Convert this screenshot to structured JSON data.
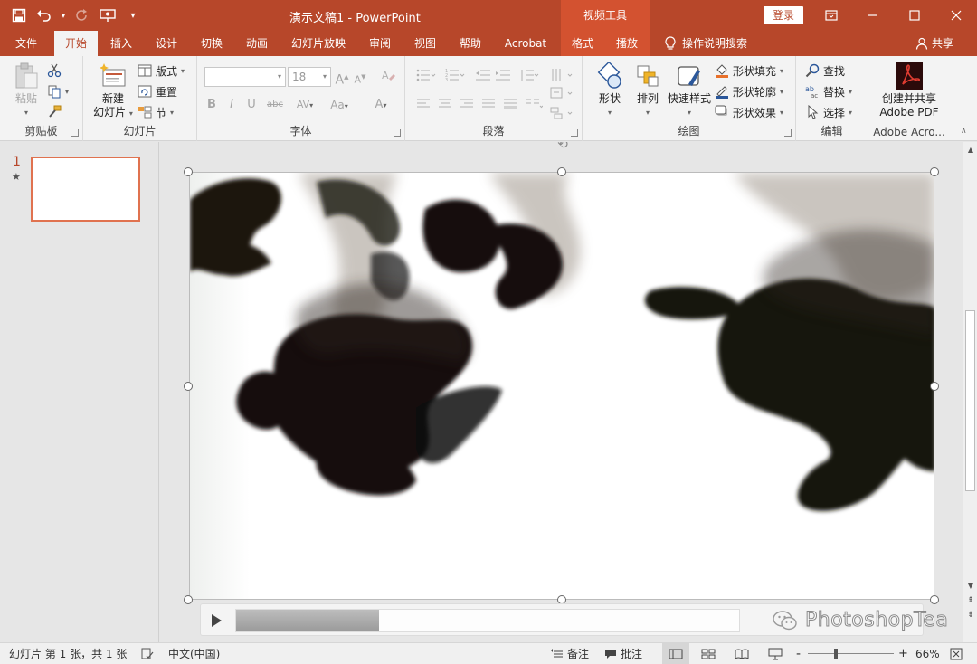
{
  "titlebar": {
    "title": "演示文稿1  -  PowerPoint",
    "context_group": "视频工具",
    "login_label": "登录"
  },
  "tabs": [
    {
      "label": "文件"
    },
    {
      "label": "开始"
    },
    {
      "label": "插入"
    },
    {
      "label": "设计"
    },
    {
      "label": "切换"
    },
    {
      "label": "动画"
    },
    {
      "label": "幻灯片放映"
    },
    {
      "label": "审阅"
    },
    {
      "label": "视图"
    },
    {
      "label": "帮助"
    },
    {
      "label": "Acrobat"
    },
    {
      "label": "格式"
    },
    {
      "label": "播放"
    }
  ],
  "active_tab": "开始",
  "tell_me": "操作说明搜索",
  "share": "共享",
  "ribbon": {
    "clipboard": {
      "label": "剪贴板",
      "paste": "粘贴"
    },
    "slides": {
      "label": "幻灯片",
      "new_slide_line1": "新建",
      "new_slide_line2": "幻灯片",
      "layout": "版式",
      "reset": "重置",
      "section": "节"
    },
    "font": {
      "label": "字体",
      "font_size": "18",
      "bold": "B",
      "italic": "I",
      "underline": "U",
      "strike": "abc",
      "spacing": "AV",
      "case": "Aa",
      "color": "A",
      "grow": "A",
      "shrink": "A"
    },
    "paragraph": {
      "label": "段落"
    },
    "drawing": {
      "label": "绘图",
      "shapes": "形状",
      "arrange": "排列",
      "quick_styles": "快速样式",
      "fill": "形状填充",
      "outline": "形状轮廓",
      "effects": "形状效果"
    },
    "editing": {
      "label": "编辑",
      "find": "查找",
      "replace": "替换",
      "select": "选择"
    },
    "adobe": {
      "label": "Adobe Acro...",
      "btn_line1": "创建并共享",
      "btn_line2": "Adobe PDF"
    }
  },
  "thumbnails": [
    {
      "number": "1",
      "marker": "★"
    }
  ],
  "player": {
    "progress": 0.285,
    "watermark": "PhotoshopTea"
  },
  "status": {
    "slide_info": "幻灯片 第 1 张，共 1 张",
    "language": "中文(中国)",
    "notes": "备注",
    "comments": "批注",
    "zoom_minus": "-",
    "zoom_plus": "+",
    "zoom_level": "66%",
    "zoom_fraction": 0.33
  },
  "colors": {
    "accent": "#b7472a",
    "context": "#d35230"
  }
}
